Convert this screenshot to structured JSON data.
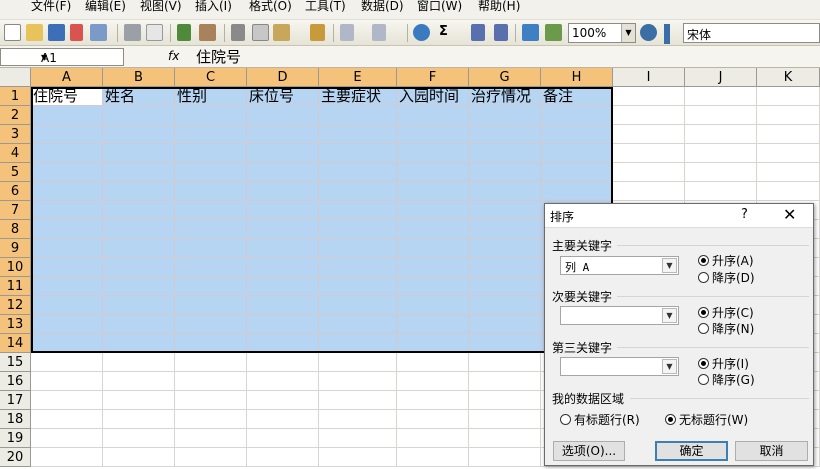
{
  "menu": [
    "文件(F)",
    "编辑(E)",
    "视图(V)",
    "插入(I)",
    "格式(O)",
    "工具(T)",
    "数据(D)",
    "窗口(W)",
    "帮助(H)"
  ],
  "toolbar": {
    "zoom": "100%",
    "font": "宋体"
  },
  "formula_bar": {
    "name_box": "A1",
    "fx": "fx",
    "content": "住院号"
  },
  "columns": [
    "A",
    "B",
    "C",
    "D",
    "E",
    "F",
    "G",
    "H",
    "I",
    "J",
    "K"
  ],
  "rows": [
    "1",
    "2",
    "3",
    "4",
    "5",
    "6",
    "7",
    "8",
    "9",
    "10",
    "11",
    "12",
    "13",
    "14",
    "15",
    "16",
    "17",
    "18",
    "19",
    "20"
  ],
  "header_row": [
    "住院号",
    "姓名",
    "性别",
    "床位号",
    "主要症状",
    "入园时间",
    "治疗情况",
    "备注"
  ],
  "sort_dialog": {
    "title": "排序",
    "help": "?",
    "close": "✕",
    "primary_key": {
      "label": "主要关键字",
      "value": "列 A",
      "asc": "升序(A)",
      "desc": "降序(D)",
      "order": "asc"
    },
    "secondary_key": {
      "label": "次要关键字",
      "value": "",
      "asc": "升序(C)",
      "desc": "降序(N)",
      "order": "asc"
    },
    "tertiary_key": {
      "label": "第三关键字",
      "value": "",
      "asc": "升序(I)",
      "desc": "降序(G)",
      "order": "asc"
    },
    "data_range": {
      "label": "我的数据区域",
      "has_header": "有标题行(R)",
      "no_header": "无标题行(W)",
      "selected": "no_header"
    },
    "options_button": "选项(O)...",
    "ok_button": "确定",
    "cancel_button": "取消"
  },
  "colors": {
    "selection": "#b6d5f3",
    "selected_header": "#f5c27c",
    "header_bg": "#ecebe4"
  }
}
